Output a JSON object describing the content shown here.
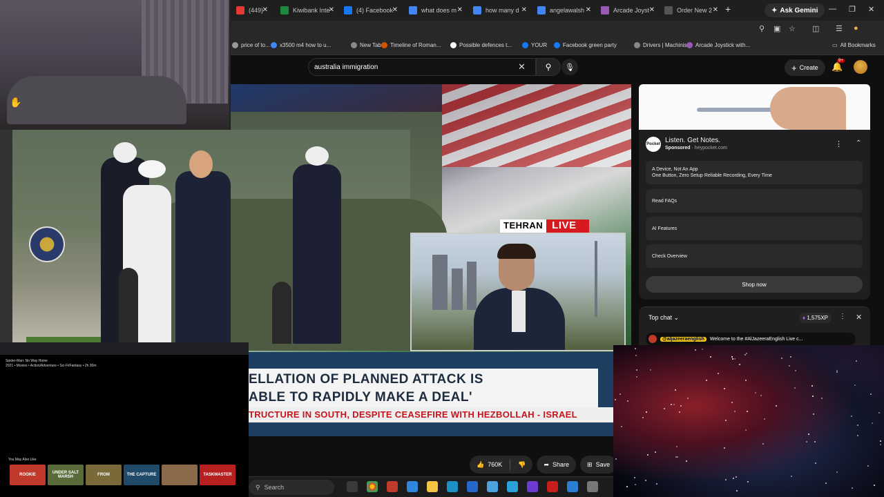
{
  "browser": {
    "tabs": [
      {
        "title": "(449)",
        "color": "#e53935"
      },
      {
        "title": "Kiwibank Inte",
        "color": "#1b8a3a"
      },
      {
        "title": "(4) Facebook",
        "color": "#1877f2"
      },
      {
        "title": "what does m",
        "color": "#4285f4"
      },
      {
        "title": "how many d",
        "color": "#4285f4"
      },
      {
        "title": "angelawalsh",
        "color": "#4285f4"
      },
      {
        "title": "Arcade Joyst",
        "color": "#9b59b6"
      },
      {
        "title": "Order New 2",
        "color": "#555555"
      }
    ],
    "new_tab_icon": "+",
    "gemini_label": "Ask Gemini",
    "bookmarks": [
      {
        "label": "price of to..."
      },
      {
        "label": "x3500 m4 how to u..."
      },
      {
        "label": "New Tab"
      },
      {
        "label": "Timeline of Roman..."
      },
      {
        "label": "Possible defences t..."
      },
      {
        "label": "YOUR"
      },
      {
        "label": "Facebook green party"
      },
      {
        "label": "Drivers | Machinist"
      },
      {
        "label": "Arcade Joystick with..."
      }
    ],
    "all_bookmarks": "All Bookmarks"
  },
  "youtube": {
    "search_value": "australia immigration",
    "create_label": "Create",
    "notif_count": "9+"
  },
  "video": {
    "live_city": "TEHRAN",
    "live_label": "LIVE",
    "headline_line1": "ELLATION OF PLANNED ATTACK IS",
    "headline_line2": "ABLE TO RAPIDLY MAKE A DEAL'",
    "ticker": "TRUCTURE IN SOUTH, DESPITE CEASEFIRE WITH HEZBOLLAH  -  ISRAEL"
  },
  "actions": {
    "likes": "760K",
    "share": "Share",
    "save": "Save"
  },
  "ad": {
    "title": "Listen. Get Notes.",
    "sponsored": "Sponsored",
    "domain": "heypocket.com",
    "logo_text": "Pocket",
    "link1_title": "A Device, Not An App",
    "link1_desc": "One Button, Zero Setup Reliable Recording, Every Time",
    "link2": "Read FAQs",
    "link3": "AI Features",
    "link4": "Check Overview",
    "shop": "Shop now"
  },
  "chat": {
    "title": "Top chat",
    "xp": "1,575XP",
    "pinned_handle": "@aljazeeraenglish",
    "pinned_message": "Welcome to the #AlJazeeraEnglish Live c..."
  },
  "stream_overlay": {
    "title": "Spider-Man: No Way Home",
    "meta": "2021 • Movies • Action/Adventure • Sci-Fi/Fantasy • 2h 30m",
    "also_like": "You May Also Like",
    "posters": [
      {
        "label": "ROOKIE",
        "color": "#c0392b"
      },
      {
        "label": "UNDER SALT MARSH",
        "color": "#5a6b3a"
      },
      {
        "label": "FROM",
        "color": "#7a6a3a"
      },
      {
        "label": "THE CAPTURE",
        "color": "#1f4a6a"
      },
      {
        "label": "",
        "color": "#8a6a4a"
      },
      {
        "label": "TASKMASTER",
        "color": "#b82020"
      }
    ]
  },
  "taskbar": {
    "search_placeholder": "Search"
  }
}
